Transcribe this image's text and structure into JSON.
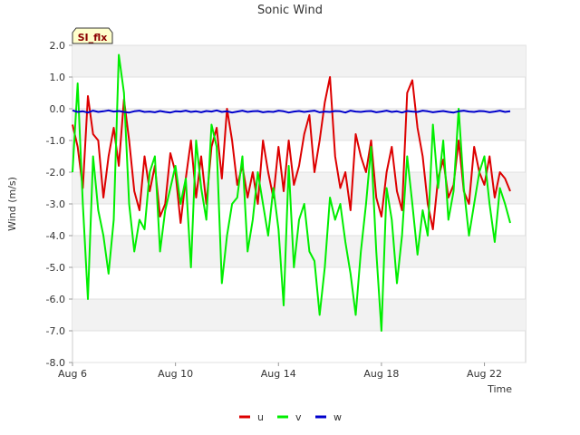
{
  "chart_data": {
    "type": "line",
    "title": "Sonic Wind",
    "xlabel": "Time",
    "ylabel": "Wind (m/s)",
    "badge": "SI_flx",
    "xlim": [
      0,
      17.6
    ],
    "ylim": [
      -8.0,
      2.0
    ],
    "x_ticks": [
      {
        "label": "Aug 6",
        "value": 0
      },
      {
        "label": "Aug 10",
        "value": 4
      },
      {
        "label": "Aug 14",
        "value": 8
      },
      {
        "label": "Aug 18",
        "value": 12
      },
      {
        "label": "Aug 22",
        "value": 16
      }
    ],
    "y_ticks": [
      {
        "label": "2.0",
        "value": 2.0
      },
      {
        "label": "1.0",
        "value": 1.0
      },
      {
        "label": "0.0",
        "value": 0.0
      },
      {
        "label": "-1.0",
        "value": -1.0
      },
      {
        "label": "-2.0",
        "value": -2.0
      },
      {
        "label": "-3.0",
        "value": -3.0
      },
      {
        "label": "-4.0",
        "value": -4.0
      },
      {
        "label": "-5.0",
        "value": -5.0
      },
      {
        "label": "-6.0",
        "value": -6.0
      },
      {
        "label": "-7.0",
        "value": -7.0
      },
      {
        "label": "-8.0",
        "value": -8.0
      }
    ],
    "grid": true,
    "legend_position": "bottom-center",
    "x": [
      0.0,
      0.2,
      0.4,
      0.6,
      0.8,
      1.0,
      1.2,
      1.4,
      1.6,
      1.8,
      2.0,
      2.2,
      2.4,
      2.6,
      2.8,
      3.0,
      3.2,
      3.4,
      3.6,
      3.8,
      4.0,
      4.2,
      4.4,
      4.6,
      4.8,
      5.0,
      5.2,
      5.4,
      5.6,
      5.8,
      6.0,
      6.2,
      6.4,
      6.6,
      6.8,
      7.0,
      7.2,
      7.4,
      7.6,
      7.8,
      8.0,
      8.2,
      8.4,
      8.6,
      8.8,
      9.0,
      9.2,
      9.4,
      9.6,
      9.8,
      10.0,
      10.2,
      10.4,
      10.6,
      10.8,
      11.0,
      11.2,
      11.4,
      11.6,
      11.8,
      12.0,
      12.2,
      12.4,
      12.6,
      12.8,
      13.0,
      13.2,
      13.4,
      13.6,
      13.8,
      14.0,
      14.2,
      14.4,
      14.6,
      14.8,
      15.0,
      15.2,
      15.4,
      15.6,
      15.8,
      16.0,
      16.2,
      16.4,
      16.6,
      16.8,
      17.0
    ],
    "series": [
      {
        "name": "u",
        "color": "#dd0000",
        "values": [
          -0.5,
          -1.2,
          -2.5,
          0.4,
          -0.8,
          -1.0,
          -2.8,
          -1.5,
          -0.6,
          -1.8,
          0.3,
          -1.0,
          -2.6,
          -3.2,
          -1.5,
          -2.6,
          -1.8,
          -3.4,
          -3.0,
          -1.4,
          -2.0,
          -3.6,
          -2.2,
          -1.0,
          -2.8,
          -1.5,
          -3.0,
          -1.2,
          -0.6,
          -2.2,
          0.0,
          -1.0,
          -2.4,
          -1.8,
          -2.8,
          -2.0,
          -3.0,
          -1.0,
          -2.0,
          -2.8,
          -1.2,
          -2.6,
          -1.0,
          -2.4,
          -1.8,
          -0.8,
          -0.2,
          -2.0,
          -1.0,
          0.2,
          1.0,
          -1.5,
          -2.5,
          -2.0,
          -3.2,
          -0.8,
          -1.5,
          -2.0,
          -1.0,
          -2.8,
          -3.4,
          -2.0,
          -1.2,
          -2.6,
          -3.2,
          0.5,
          0.9,
          -0.6,
          -1.5,
          -3.0,
          -3.8,
          -2.2,
          -1.6,
          -2.8,
          -2.4,
          -1.0,
          -2.6,
          -3.0,
          -1.2,
          -2.0,
          -2.4,
          -1.5,
          -2.8,
          -2.0,
          -2.2,
          -2.6
        ]
      },
      {
        "name": "v",
        "color": "#00ee00",
        "values": [
          -2.0,
          0.8,
          -3.0,
          -6.0,
          -1.5,
          -3.2,
          -4.0,
          -5.2,
          -3.5,
          1.7,
          0.5,
          -3.0,
          -4.5,
          -3.5,
          -3.8,
          -2.0,
          -1.5,
          -4.5,
          -3.2,
          -2.5,
          -1.8,
          -3.0,
          -2.2,
          -5.0,
          -1.0,
          -2.5,
          -3.5,
          -0.5,
          -1.2,
          -5.5,
          -4.0,
          -3.0,
          -2.8,
          -1.5,
          -4.5,
          -3.5,
          -2.0,
          -3.0,
          -4.0,
          -2.5,
          -3.8,
          -6.2,
          -1.8,
          -5.0,
          -3.5,
          -3.0,
          -4.5,
          -4.8,
          -6.5,
          -5.0,
          -2.8,
          -3.5,
          -3.0,
          -4.2,
          -5.2,
          -6.5,
          -4.5,
          -3.0,
          -1.2,
          -4.5,
          -7.0,
          -2.5,
          -3.5,
          -5.5,
          -4.0,
          -1.5,
          -3.0,
          -4.6,
          -3.2,
          -4.0,
          -0.5,
          -2.5,
          -1.0,
          -3.5,
          -2.6,
          0.0,
          -2.5,
          -4.0,
          -3.0,
          -2.0,
          -1.5,
          -3.0,
          -4.2,
          -2.5,
          -3.0,
          -3.6
        ]
      },
      {
        "name": "w",
        "color": "#0000cc",
        "values": [
          -0.05,
          -0.1,
          -0.08,
          -0.12,
          -0.06,
          -0.1,
          -0.08,
          -0.05,
          -0.09,
          -0.07,
          -0.1,
          -0.12,
          -0.08,
          -0.06,
          -0.1,
          -0.09,
          -0.11,
          -0.07,
          -0.1,
          -0.12,
          -0.08,
          -0.09,
          -0.06,
          -0.1,
          -0.08,
          -0.11,
          -0.07,
          -0.09,
          -0.05,
          -0.1,
          -0.08,
          -0.12,
          -0.09,
          -0.06,
          -0.1,
          -0.08,
          -0.07,
          -0.11,
          -0.09,
          -0.1,
          -0.06,
          -0.08,
          -0.12,
          -0.09,
          -0.07,
          -0.1,
          -0.08,
          -0.06,
          -0.11,
          -0.09,
          -0.1,
          -0.07,
          -0.08,
          -0.12,
          -0.06,
          -0.09,
          -0.1,
          -0.08,
          -0.07,
          -0.11,
          -0.09,
          -0.06,
          -0.1,
          -0.08,
          -0.12,
          -0.07,
          -0.09,
          -0.1,
          -0.06,
          -0.08,
          -0.11,
          -0.09,
          -0.07,
          -0.1,
          -0.12,
          -0.08,
          -0.06,
          -0.09,
          -0.1,
          -0.07,
          -0.08,
          -0.11,
          -0.09,
          -0.06,
          -0.1,
          -0.08
        ]
      }
    ]
  }
}
